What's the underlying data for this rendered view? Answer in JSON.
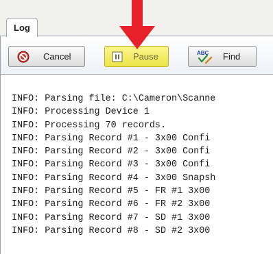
{
  "tabs": [
    {
      "label": "Log"
    }
  ],
  "toolbar": {
    "cancel_label": "Cancel",
    "pause_label": "Pause",
    "find_label": "Find",
    "find_icon_text": "ABC"
  },
  "icons": {
    "cancel": "cancel-icon",
    "pause": "pause-icon",
    "find": "spell-find-icon",
    "annotation": "red-down-arrow"
  },
  "colors": {
    "annotation_arrow": "#e8202a",
    "pause_button_bg": "#f2eb5c"
  },
  "log": {
    "lines": [
      "INFO: Parsing file: C:\\Cameron\\Scanne",
      "INFO: Processing Device 1",
      "INFO: Processing 70 records.",
      "INFO: Parsing Record #1 - 3x00 Confi",
      "INFO: Parsing Record #2 - 3x00 Confi",
      "INFO: Parsing Record #3 - 3x00 Confi",
      "INFO: Parsing Record #4 - 3x00 Snapsh",
      "INFO: Parsing Record #5 - FR #1 3x00",
      "INFO: Parsing Record #6 - FR #2 3x00",
      "INFO: Parsing Record #7 - SD #1 3x00",
      "INFO: Parsing Record #8 - SD #2 3x00"
    ]
  }
}
